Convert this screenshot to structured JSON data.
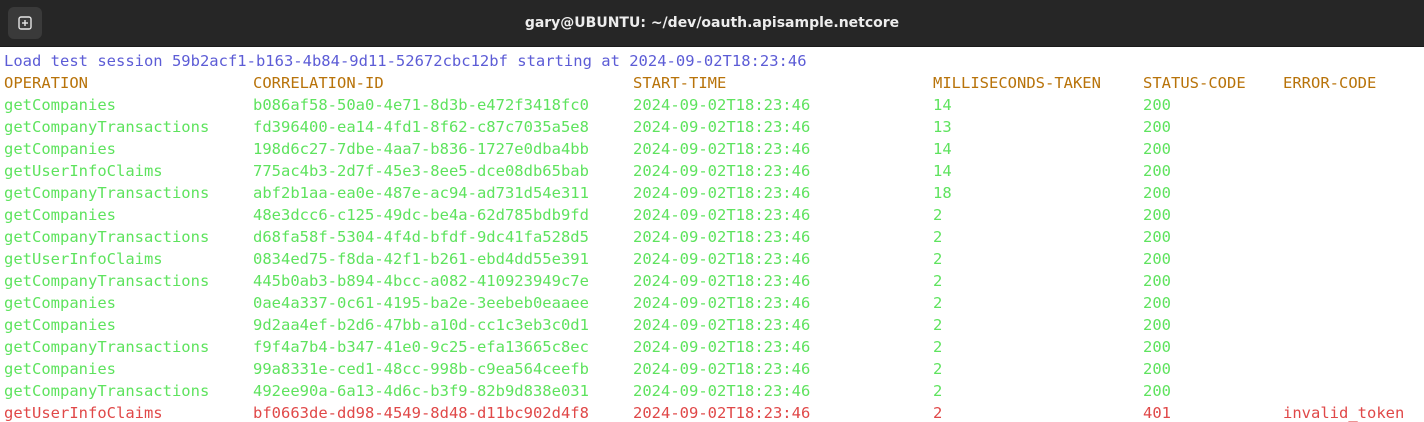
{
  "window": {
    "title": "gary@UBUNTU: ~/dev/oauth.apisample.netcore",
    "new_tab_icon": "new-tab-icon"
  },
  "colors": {
    "session": "#5c5cd6",
    "header": "#b8730a",
    "ok": "#5ee35e",
    "error": "#e04848"
  },
  "terminal": {
    "session_line": "Load test session 59b2acf1-b163-4b84-9d11-52672cbc12bf starting at 2024-09-02T18:23:46",
    "headers": [
      "OPERATION",
      "CORRELATION-ID",
      "START-TIME",
      "MILLISECONDS-TAKEN",
      "STATUS-CODE",
      "ERROR-CODE"
    ],
    "rows": [
      {
        "operation": "getCompanies",
        "correlation_id": "b086af58-50a0-4e71-8d3b-e472f3418fc0",
        "start_time": "2024-09-02T18:23:46",
        "ms": "14",
        "status": "200",
        "error": ""
      },
      {
        "operation": "getCompanyTransactions",
        "correlation_id": "fd396400-ea14-4fd1-8f62-c87c7035a5e8",
        "start_time": "2024-09-02T18:23:46",
        "ms": "13",
        "status": "200",
        "error": ""
      },
      {
        "operation": "getCompanies",
        "correlation_id": "198d6c27-7dbe-4aa7-b836-1727e0dba4bb",
        "start_time": "2024-09-02T18:23:46",
        "ms": "14",
        "status": "200",
        "error": ""
      },
      {
        "operation": "getUserInfoClaims",
        "correlation_id": "775ac4b3-2d7f-45e3-8ee5-dce08db65bab",
        "start_time": "2024-09-02T18:23:46",
        "ms": "14",
        "status": "200",
        "error": ""
      },
      {
        "operation": "getCompanyTransactions",
        "correlation_id": "abf2b1aa-ea0e-487e-ac94-ad731d54e311",
        "start_time": "2024-09-02T18:23:46",
        "ms": "18",
        "status": "200",
        "error": ""
      },
      {
        "operation": "getCompanies",
        "correlation_id": "48e3dcc6-c125-49dc-be4a-62d785bdb9fd",
        "start_time": "2024-09-02T18:23:46",
        "ms": "2",
        "status": "200",
        "error": ""
      },
      {
        "operation": "getCompanyTransactions",
        "correlation_id": "d68fa58f-5304-4f4d-bfdf-9dc41fa528d5",
        "start_time": "2024-09-02T18:23:46",
        "ms": "2",
        "status": "200",
        "error": ""
      },
      {
        "operation": "getUserInfoClaims",
        "correlation_id": "0834ed75-f8da-42f1-b261-ebd4dd55e391",
        "start_time": "2024-09-02T18:23:46",
        "ms": "2",
        "status": "200",
        "error": ""
      },
      {
        "operation": "getCompanyTransactions",
        "correlation_id": "445b0ab3-b894-4bcc-a082-410923949c7e",
        "start_time": "2024-09-02T18:23:46",
        "ms": "2",
        "status": "200",
        "error": ""
      },
      {
        "operation": "getCompanies",
        "correlation_id": "0ae4a337-0c61-4195-ba2e-3eebeb0eaaee",
        "start_time": "2024-09-02T18:23:46",
        "ms": "2",
        "status": "200",
        "error": ""
      },
      {
        "operation": "getCompanies",
        "correlation_id": "9d2aa4ef-b2d6-47bb-a10d-cc1c3eb3c0d1",
        "start_time": "2024-09-02T18:23:46",
        "ms": "2",
        "status": "200",
        "error": ""
      },
      {
        "operation": "getCompanyTransactions",
        "correlation_id": "f9f4a7b4-b347-41e0-9c25-efa13665c8ec",
        "start_time": "2024-09-02T18:23:46",
        "ms": "2",
        "status": "200",
        "error": ""
      },
      {
        "operation": "getCompanies",
        "correlation_id": "99a8331e-ced1-48cc-998b-c9ea564ceefb",
        "start_time": "2024-09-02T18:23:46",
        "ms": "2",
        "status": "200",
        "error": ""
      },
      {
        "operation": "getCompanyTransactions",
        "correlation_id": "492ee90a-6a13-4d6c-b3f9-82b9d838e031",
        "start_time": "2024-09-02T18:23:46",
        "ms": "2",
        "status": "200",
        "error": ""
      },
      {
        "operation": "getUserInfoClaims",
        "correlation_id": "bf0663de-dd98-4549-8d48-d11bc902d4f8",
        "start_time": "2024-09-02T18:23:46",
        "ms": "2",
        "status": "401",
        "error": "invalid_token"
      }
    ]
  }
}
